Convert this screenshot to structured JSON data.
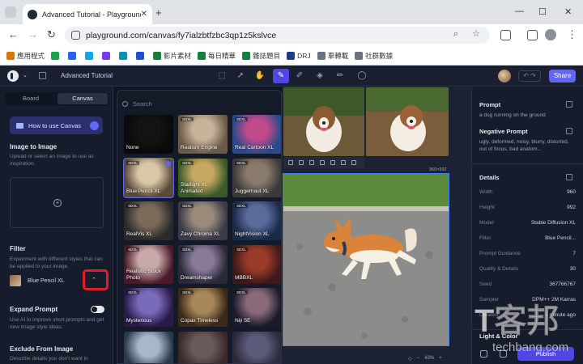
{
  "browser": {
    "tab_title": "Advanced Tutorial - Playground",
    "new_tab": "+",
    "url": "playground.com/canvas/fy7ialzbtfzbc3qp1z5kslvce",
    "bookmarks": [
      "應用程式",
      "",
      "",
      "",
      "",
      "",
      "",
      "影片素材",
      "每日精華",
      "雜誌題目",
      "DRJ",
      "車轉載",
      "社群數據"
    ]
  },
  "app": {
    "doc_title": "Advanced Tutorial",
    "share_label": "Share",
    "left": {
      "tabs": [
        "Board",
        "Canvas"
      ],
      "howto_label": "How to use Canvas",
      "image_to_image_title": "Image to Image",
      "image_to_image_desc": "Upload or select an image to use as inspiration.",
      "filter_title": "Filter",
      "filter_desc": "Experiment with different styles that can be applied to your image.",
      "filter_selected": "Blue Pencil XL",
      "expand_prompt_title": "Expand Prompt",
      "expand_prompt_desc": "Use AI to improve short prompts and get new image style ideas.",
      "exclude_title": "Exclude From Image",
      "exclude_desc": "Describe details you don't want in"
    },
    "dropdown": {
      "search_placeholder": "Search",
      "badge": "SDXL",
      "items": [
        {
          "name": "None"
        },
        {
          "name": "Realism Engine"
        },
        {
          "name": "Real Cartoon XL"
        },
        {
          "name": "Blue Pencil XL"
        },
        {
          "name": "Starlight XL Animated"
        },
        {
          "name": "Juggernaut XL"
        },
        {
          "name": "RealVis XL"
        },
        {
          "name": "Zavy Chroma XL"
        },
        {
          "name": "NightVision XL"
        },
        {
          "name": "Realistic Stock Photo"
        },
        {
          "name": "Dreamshaper"
        },
        {
          "name": "MBBXL"
        },
        {
          "name": "Mysterious"
        },
        {
          "name": "Copax Timeless"
        },
        {
          "name": "Niji SE"
        },
        {
          "name": ""
        },
        {
          "name": ""
        },
        {
          "name": ""
        }
      ]
    },
    "canvas": {
      "dims": "960×992",
      "zoom": "43%"
    },
    "right": {
      "prompt_title": "Prompt",
      "prompt_text": "a dog running on the ground",
      "neg_title": "Negative Prompt",
      "neg_text": "ugly, deformed, noisy, blurry, distorted, out of focus, bad anatom...",
      "details_title": "Details",
      "details": [
        {
          "k": "Width",
          "v": "960"
        },
        {
          "k": "Height",
          "v": "992"
        },
        {
          "k": "Model",
          "v": "Stable Diffusion XL"
        },
        {
          "k": "Filter",
          "v": "Blue Pencil..."
        },
        {
          "k": "Prompt Guidance",
          "v": "7"
        },
        {
          "k": "Quality & Details",
          "v": "30"
        },
        {
          "k": "Seed",
          "v": "367766767"
        },
        {
          "k": "Sampler",
          "v": "DPM++ 2M Karras"
        },
        {
          "k": "Created",
          "v": "1 minute ago"
        }
      ],
      "light_color": "Light & Color",
      "publish_label": "Publish"
    }
  },
  "watermark": {
    "cn": "T客邦",
    "en": "techbang.com"
  }
}
